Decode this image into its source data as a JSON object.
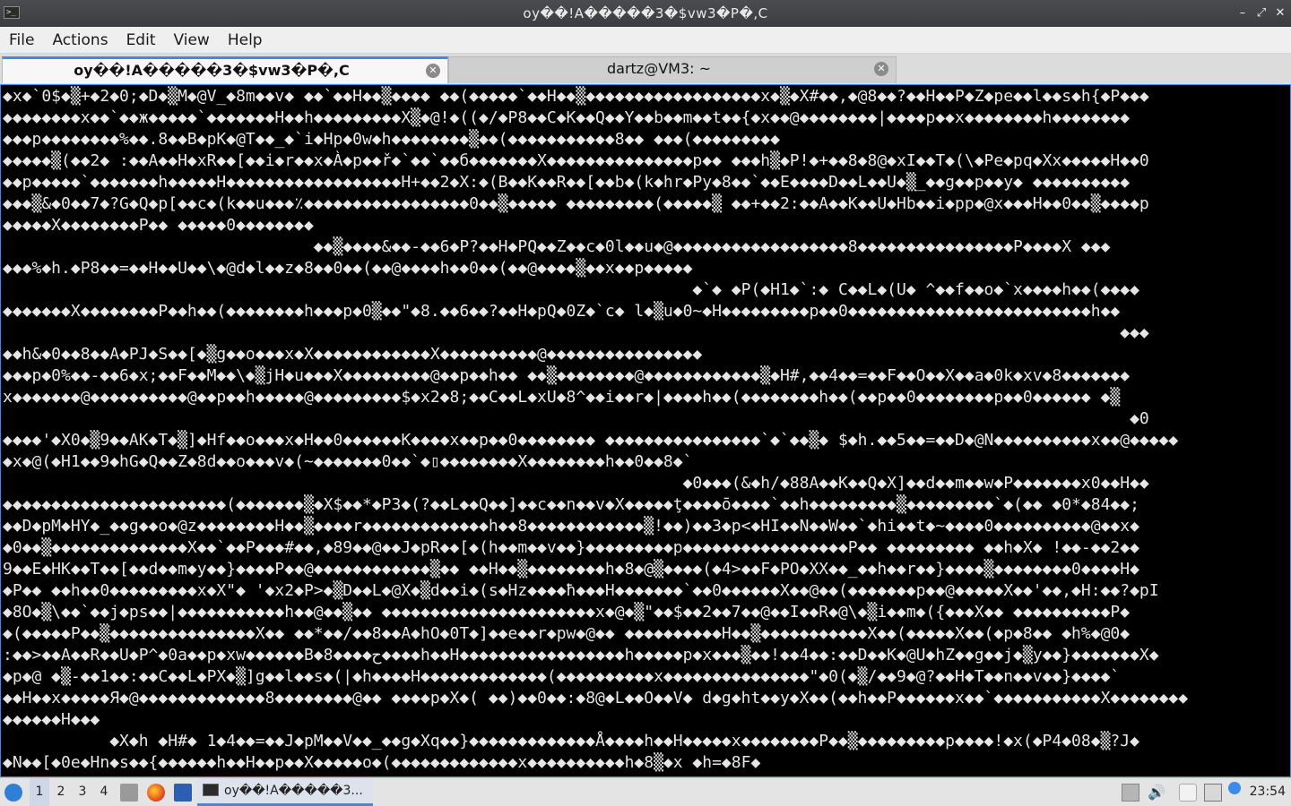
{
  "window": {
    "title": "oy��!A�����3�$vw3�P�,C",
    "app_icon_glyph": ">_",
    "minimize_glyph": "–",
    "maximize_glyph": "⤢",
    "close_glyph": "✕"
  },
  "menu": {
    "file": "File",
    "actions": "Actions",
    "edit": "Edit",
    "view": "View",
    "help": "Help"
  },
  "tabs": [
    {
      "label": "oy��!A�����3�$vw3�P�,C",
      "close": "✕"
    },
    {
      "label": "dartz@VM3: ~",
      "close": "✕"
    }
  ],
  "terminal": {
    "lines": [
      "◆x◆`0$◆▒+◆2◆0;◆D◆▒M◆@V_◆8m◆◆v◆ ◆◆`◆◆H◆◆▒◆◆◆◆ ◆◆(◆◆◆◆◆`◆◆H◆◆▒◆◆◆◆◆◆◆◆◆◆◆◆◆◆◆◆◆◆x◆▒◆X#◆◆,◆@8◆◆?◆◆H◆◆P◆Z◆pe◆◆l◆◆s◆h{◆P◆◆◆",
      "◆◆◆◆◆◆◆◆x◆◆`◆◆ж◆◆◆◆◆`◆◆◆◆◆◆◆H◆◆h◆◆◆◆◆◆◆◆◆X▒◆@!◆((◆/◆P8◆◆C◆K◆◆Q◆◆Y◆◆b◆◆m◆◆t◆◆{◆x◆◆@◆◆◆◆◆◆◆◆|◆◆◆◆p◆◆x◆◆◆◆◆◆◆◆h◆◆◆◆◆◆◆◆",
      "◆◆◆p◆◆◆◆◆◆◆◆%◆◆.8◆◆B◆pK◆@T◆◆_◆`i◆Hp◆0w◆h◆◆◆◆◆◆◆◆▒◆◆(◆◆◆◆◆◆◆◆◆◆◆8◆◆ ◆◆◆(◆◆◆◆◆◆◆◆◆",
      "◆◆◆◆◆▒(◆◆2◆ :◆◆A◆◆H◆xR◆◆[◆◆i◆r◆◆x◆À◆p◆◆ř◆`◆◆`◆◆б◆◆◆◆◆◆◆X◆◆◆◆◆◆◆◆◆◆◆◆◆◆◆p◆◆ ◆◆◆h▒◆P!◆+◆◆8◆8@◆xI◆◆T◆(\\◆Pe◆pq◆Xx◆◆◆◆◆H◆◆0",
      "◆◆p◆◆◆◆◆`◆◆◆◆◆◆◆h◆◆◆◆◆H◆◆◆◆◆◆◆◆◆◆◆◆◆◆◆◆◆◆H+◆◆2◆X:◆(B◆◆K◆◆R◆◆[◆◆b◆(k◆hr◆Py◆8◆◆`◆◆E◆◆◆◆D◆◆L◆◆U◆▒_◆◆g◆◆p◆◆y◆ ◆◆◆◆◆◆◆◆◆◆",
      "◆◆◆▒&◆0◆◆7◆?G◆Q◆p[◆◆c◆(k◆◆u◆◆◆٪◆◆◆◆◆◆◆◆◆◆◆◆◆◆◆◆◆0◆◆▒◆◆◆◆◆ ◆◆◆◆◆◆◆◆◆(◆◆◆◆◆▒ ◆◆+◆◆2:◆◆A◆◆K◆◆U◆Hb◆◆i◆pp◆@x◆◆◆H◆◆0◆◆▒◆◆◆◆p",
      "◆◆◆◆◆X◆◆◆◆◆◆◆◆P◆◆ ◆◆◆◆◆0◆◆◆◆◆◆◆◆",
      "                                ◆◆▒◆◆◆◆&◆◆-◆◆6◆P?◆◆H◆PQ◆◆Z◆◆c◆0l◆◆u◆@◆◆◆◆◆◆◆◆◆◆◆◆◆◆◆◆◆◆8◆◆◆◆◆◆◆◆◆◆◆◆◆◆◆◆P◆◆◆◆X ◆◆◆",
      "◆◆◆%◆h.◆P8◆◆=◆◆H◆◆U◆◆\\◆@d◆l◆◆z◆8◆◆0◆◆(◆◆@◆◆◆◆h◆◆0◆◆(◆◆@◆◆◆◆▒◆◆x◆◆p◆◆◆◆◆",
      "                                                                       ◆`◆ ◆P(◆H1◆`:◆ C◆◆L◆(U◆ ^◆◆f◆◆o◆`x◆◆◆◆h◆◆(◆◆◆◆",
      "◆◆◆◆◆◆◆X◆◆◆◆◆◆◆◆P◆◆h◆◆(◆◆◆◆◆◆◆◆h◆◆◆p◆0▒◆◆\"◆8.◆◆6◆◆?◆◆H◆pQ◆0Z◆`c◆ l◆▒u◆0~◆H◆◆◆◆◆◆◆◆◆p◆◆0◆◆◆◆◆◆◆◆◆◆◆◆◆◆◆◆◆◆◆◆◆◆◆◆◆h◆◆",
      "                                                                                                                   ◆◆◆",
      "◆◆h&◆0◆◆8◆◆A◆PJ◆S◆◆[◆▒g◆◆o◆◆◆x◆X◆◆◆◆◆◆◆◆◆◆◆◆X◆◆◆◆◆◆◆◆◆◆@◆◆◆◆◆◆◆◆◆◆◆◆◆◆◆◆",
      "◆◆◆p◆0%◆◆-◆◆6◆x;◆◆F◆◆M◆◆\\◆▒jH◆u◆◆◆X◆◆◆◆◆◆◆◆◆@◆◆p◆◆h◆◆ ◆◆▒◆◆◆◆◆◆◆◆@◆◆◆◆◆◆◆◆◆◆◆◆▒◆H#,◆◆4◆◆=◆◆F◆◆O◆◆X◆◆a◆0k◆xv◆8◆◆◆◆◆◆◆",
      "x◆◆◆◆◆◆◆@◆◆◆◆◆◆◆◆◆◆@◆◆p◆◆h◆◆◆◆◆@◆◆◆◆◆◆◆◆◆$◆x2◆8;◆◆C◆◆L◆xU◆8^◆◆i◆◆r◆|◆◆◆◆h◆◆(◆◆◆◆◆◆◆◆h◆◆(◆◆p◆◆0◆◆◆◆◆◆◆◆p◆◆0◆◆◆◆◆◆ ◆▒",
      "                                                                                                                    ◆0",
      "◆◆◆◆'◆X0◆▒9◆◆AK◆T◆▒]◆Hf◆◆o◆◆◆x◆H◆◆0◆◆◆◆◆◆K◆◆◆◆x◆◆p◆◆0◆◆◆◆◆◆◆◆ ◆◆◆◆◆◆◆◆◆◆◆◆◆◆◆◆`◆`◆◆▒◆ $◆h.◆◆5◆◆=◆◆D◆@N◆◆◆◆◆◆◆◆◆◆x◆◆@◆◆◆◆◆",
      "◆x◆@(◆H1◆◆9◆hG◆Q◆◆Z◆8d◆◆o◆◆◆v◆(~◆◆◆◆◆◆◆0◆◆`◆▯◆◆◆◆◆◆◆◆X◆◆◆◆◆◆◆◆h◆◆0◆◆8◆`",
      "                                                                      ◆0◆◆◆(&◆h/◆88A◆◆K◆◆Q◆X]◆◆d◆◆m◆◆w◆P◆◆◆◆◆◆◆x0◆◆H◆◆",
      "◆◆◆◆◆◆◆◆◆◆◆◆◆◆◆◆◆◆◆◆◆◆◆(◆◆◆◆◆◆◆▒◆X$◆◆*◆P3◆(?◆◆L◆◆Q◆◆]◆◆c◆◆n◆◆v◆X◆◆◆◆◆ţ◆◆◆◆ō◆◆◆◆`◆◆h◆◆◆◆◆◆◆◆◆▒◆◆◆◆◆◆◆◆◆`◆(◆◆ ◆0*◆84◆◆;",
      "◆◆D◆pM◆HY◆_◆◆g◆◆o◆@z◆◆◆◆◆◆◆◆H◆◆▒◆◆◆◆r◆◆◆◆◆◆◆◆◆◆◆◆◆h◆◆8◆◆◆◆◆◆◆◆◆◆◆◆▒!◆◆)◆◆3◆p<◆HI◆◆N◆◆W◆◆`◆hi◆◆t◆~◆◆◆◆0◆◆◆◆◆◆◆◆◆◆@◆◆x◆",
      "◆0◆◆▒◆◆◆◆◆◆◆◆◆◆◆◆◆◆X◆◆`◆◆P◆◆◆#◆◆,◆89◆◆@◆◆J◆pR◆◆[◆(h◆◆m◆◆v◆◆}◆◆◆◆◆◆◆◆◆p◆◆◆◆◆◆◆◆◆◆◆◆◆◆◆◆◆P◆◆ ◆◆◆◆◆◆◆◆◆ ◆◆h◆X◆ !◆◆-◆◆2◆◆",
      "9◆◆E◆HK◆◆T◆◆[◆◆d◆◆m◆y◆◆}◆◆◆◆P◆◆@◆◆◆◆◆◆◆◆◆◆◆◆▒◆◆ ◆◆H◆◆▒◆◆◆◆◆◆◆◆h◆8◆@▒◆◆◆◆(◆4>◆◆F◆PO◆XX◆◆_◆◆h◆◆r◆◆}◆◆◆◆▒◆◆◆◆◆◆◆◆0◆◆◆◆H◆",
      "◆P◆◆ ◆◆h◆◆0◆◆◆◆◆◆◆◆◆x◆X\"◆ '◆x2◆P>◆▒D◆◆L◆@X◆▒d◆◆i◆(s◆Hz◆◆◆◆ħ◆◆◆H◆◆◆◆◆◆◆`◆◆0◆◆◆◆◆◆X◆◆@◆◆(◆◆◆◆◆◆◆p◆◆@◆◆◆◆◆X◆◆'◆◆,◆H:◆◆?◆pI",
      "◆8O◆▒\\◆◆`◆◆j◆ps◆◆|◆◆◆◆◆◆◆◆◆◆◆h◆◆@◆◆▒◆◆ ◆◆◆◆◆◆◆◆◆◆◆◆◆◆◆◆◆◆◆◆◆◆x◆@◆▒\"◆◆$◆◆2◆◆7◆◆@◆◆I◆◆R◆@\\◆▒i◆◆m◆({◆◆◆X◆◆ ◆◆◆◆◆◆◆◆◆◆P◆",
      "◆(◆◆◆◆◆P◆◆▒◆◆◆◆◆◆◆◆◆◆◆◆◆◆◆X◆◆ ◆◆*◆◆/◆◆8◆◆A◆hO◆0T◆]◆◆e◆◆r◆pw◆@◆◆ ◆◆◆◆◆◆◆◆◆◆H◆◆▒◆◆◆◆◆◆◆◆◆◆◆X◆◆(◆◆◆◆◆X◆◆(◆p◆8◆◆ ◆h%◆@0◆",
      ":◆◆>◆◆A◆◆R◆◆U◆P^◆0a◆◆p◆xw◆◆◆◆◆◆B◆8◆◆◆◆ح◆◆◆◆h◆◆H◆◆◆◆◆◆◆◆◆◆◆◆◆◆◆◆◆h◆◆◆◆◆p◆x◆◆◆▒◆◆!◆◆4◆◆:◆◆D◆◆K◆@U◆hZ◆◆g◆◆j◆▒y◆◆}◆◆◆◆◆◆◆X◆",
      "◆p◆@ ◆▒-◆◆1◆◆:◆◆C◆◆L◆PX◆▒]g◆◆l◆◆s◆(|◆h◆◆◆◆H◆◆◆◆◆◆◆◆◆◆◆◆◆(◆◆◆◆◆◆◆◆◆◆x◆◆◆◆◆◆◆◆◆◆◆◆◆◆◆\"◆0(◆▒/◆◆9◆@?◆◆H◆T◆◆n◆◆v◆◆}◆◆◆◆`",
      "◆◆H◆◆x◆◆◆◆◆Я◆@◆◆◆◆◆◆◆◆◆◆◆◆◆8◆◆◆◆◆◆◆◆@◆◆ ◆◆◆◆p◆X◆( ◆◆)◆◆0◆◆:◆8@◆L◆◆O◆◆V◆ d◆g◆ht◆◆y◆X◆◆(◆◆h◆◆P◆◆◆◆◆◆x◆◆`◆◆◆◆◆◆◆◆◆◆◆X◆◆◆◆◆◆◆◆",
      "◆◆◆◆◆◆H◆◆◆",
      "           ◆X◆h ◆H#◆ 1◆4◆◆=◆◆J◆pM◆◆V◆◆_◆◆g◆Xq◆◆}◆◆◆◆◆◆◆◆◆◆◆◆◆Å◆◆◆◆h◆◆H◆◆◆◆◆x◆◆◆◆◆◆◆◆P◆◆▒◆◆◆◆◆◆◆◆◆p◆◆◆◆!◆x(◆P4◆08◆▒?J◆",
      "◆N◆◆[◆0e◆Hn◆s◆◆{◆◆◆◆◆◆h◆◆H◆◆p◆◆X◆◆◆◆◆o◆(◆◆◆◆◆◆◆◆◆◆◆◆◆x◆◆◆◆◆◆◆◆◆◆h◆8▒◆x ◆h=◆8F◆"
    ]
  },
  "taskbar": {
    "start_icon": "start-menu-icon",
    "workspaces": [
      "1",
      "2",
      "3",
      "4"
    ],
    "current_workspace": "1",
    "launchers": [
      "file-manager-icon",
      "firefox-icon",
      "desktop-icon"
    ],
    "task_label": "oy��!A�����3...",
    "tray_icons": [
      "clipboard-icon",
      "volume-icon",
      "notes-icon",
      "network-icon"
    ],
    "clock": "23:54"
  },
  "colors": {
    "accent": "#3d8be8",
    "terminal_bg": "#000000",
    "terminal_fg": "#e6e6e6"
  }
}
